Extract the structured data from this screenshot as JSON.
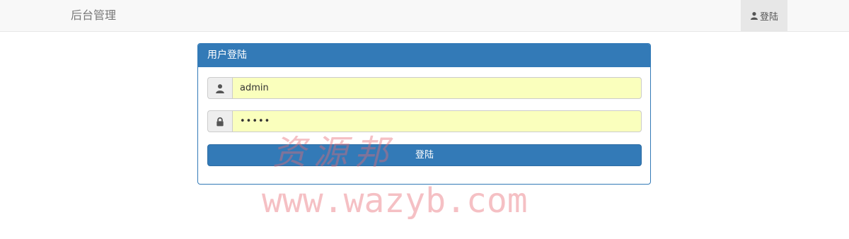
{
  "navbar": {
    "brand": "后台管理",
    "login_link": {
      "label": "登陆",
      "icon": "user-icon"
    }
  },
  "panel": {
    "heading": "用户登陆",
    "username": {
      "icon": "user-icon",
      "value": "admin"
    },
    "password": {
      "icon": "lock-icon",
      "value": "•••••"
    },
    "submit_label": "登陆"
  },
  "watermark": {
    "text": "资源邦",
    "url": "www.wazyb.com"
  },
  "colors": {
    "primary": "#337ab7",
    "autofill": "#faffbd",
    "navbar_bg": "#f8f8f8",
    "watermark": "#e86973"
  }
}
